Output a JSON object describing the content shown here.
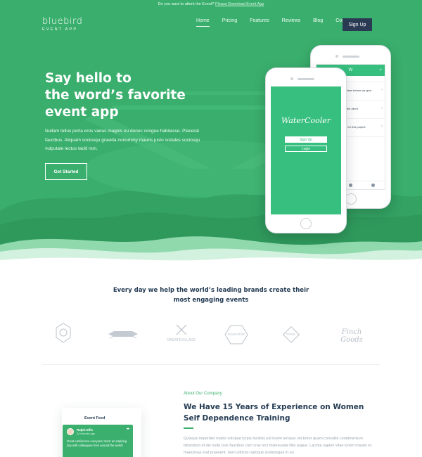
{
  "topbar": {
    "text": "Do you want to attent the Event?",
    "link": "Please Download Event App"
  },
  "logo": {
    "name": "bluebird",
    "tagline": "EVENT APP"
  },
  "nav": {
    "items": [
      "Home",
      "Pricing",
      "Features",
      "Reviews",
      "Blog",
      "Contact"
    ],
    "active": "Home",
    "signup": "Sign Up"
  },
  "hero": {
    "title_lines": [
      "Say hello to",
      "the word’s favorite",
      "event app"
    ],
    "text": "Nullam tellus porta eros varius magnis eu donec congue habitasse. Placerat faucibus. Aliquam sociosqu gravida nonummy mauris justo sodales sociosqu vulputate lectus taciti non.",
    "cta": "Get Started"
  },
  "phone_front": {
    "app_name": "WaterCooler",
    "signup": "Sign Up",
    "login": "Login"
  },
  "phone_back": {
    "search": "Search for User Name",
    "rows": [
      {
        "text": "to review more of the ideas before we give validation.",
        "time": "Today, 8:12 AM"
      },
      {
        "text": "Thank you arriving for the client",
        "time": "Today, 8:12 AM"
      },
      {
        "text": "event #beacon options for this project.",
        "time": "Today, 8:12 AM"
      }
    ]
  },
  "brands": {
    "heading": "Every day we help the world’s leading brands create their most engaging events",
    "logos": [
      "badge-logo",
      "ribbon-logo",
      "GREATEVILLAGE",
      "NAVIGATOR",
      "TITAN",
      "Finch Goods"
    ]
  },
  "about": {
    "tag": "About Our Company",
    "title": "We Have 15 Years of Experience on Women Self Dependence Training",
    "text": "Quisque imperdiet mattis volutpat turpis facilisis est lorem tempus vel tortor quam convallis condimentum bibendum et dis nulla cras faucibus cum cras orci malesuada Nisi augue. Lacinia sapien vitae lorem mauris et, maecenas erat praesent. Sem ultrices natoque scelerisque in eu"
  },
  "feed": {
    "title": "Event Feed",
    "name": "Ralph Ellis",
    "time": "24 minutes ago",
    "message": "Great conference everyone! Such an inspiring day with colleagues from around the world!"
  },
  "colors": {
    "brand_green": "#3bb06e",
    "dark": "#2b3a53",
    "heading": "#243b53"
  }
}
